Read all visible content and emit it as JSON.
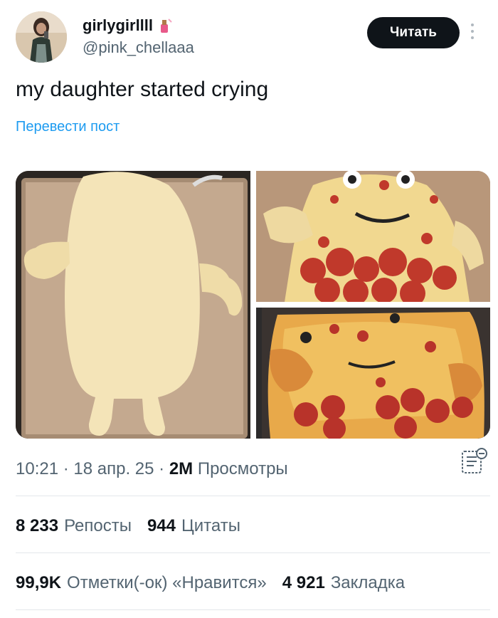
{
  "author": {
    "display_name": "girlygirllll",
    "emoji_icon": "nail-polish-icon",
    "handle": "@pink_chellaaa"
  },
  "follow_label": "Читать",
  "tweet": {
    "text": "my daughter started crying",
    "translate_label": "Перевести пост"
  },
  "meta": {
    "time": "10:21",
    "date": "18 апр. 25",
    "views_count": "2M",
    "views_label": "Просмотры",
    "separator": " · "
  },
  "stats_row1": [
    {
      "count": "8 233",
      "label": "Репосты"
    },
    {
      "count": "944",
      "label": "Цитаты"
    }
  ],
  "stats_row2": [
    {
      "count": "99,9K",
      "label": "Отметки(-ок) «Нравится»"
    },
    {
      "count": "4 921",
      "label": "Закладка"
    }
  ],
  "colors": {
    "link": "#1d9bf0",
    "muted": "#536471",
    "text": "#0f1419"
  }
}
